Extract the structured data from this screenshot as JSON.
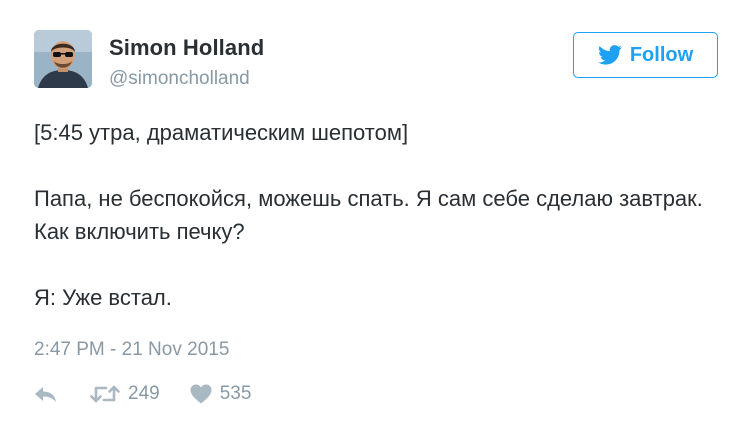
{
  "user": {
    "name": "Simon Holland",
    "handle": "@simoncholland"
  },
  "follow_button": {
    "label": "Follow",
    "icon": "twitter-bird-icon"
  },
  "tweet": {
    "line1": "[5:45 утра, драматическим шепотом]",
    "line2": "Папа, не беспокойся, можешь спать. Я сам себе сделаю завтрак. Как включить печку?",
    "line3": "Я: Уже встал.",
    "timestamp": "2:47 PM - 21 Nov 2015"
  },
  "actions": {
    "reply_icon": "reply-icon",
    "retweet_icon": "retweet-icon",
    "retweet_count": "249",
    "like_icon": "heart-icon",
    "like_count": "535"
  },
  "colors": {
    "accent": "#1da1f2",
    "text": "#292f33",
    "muted": "#8899a6",
    "icon": "#aab8c2"
  }
}
